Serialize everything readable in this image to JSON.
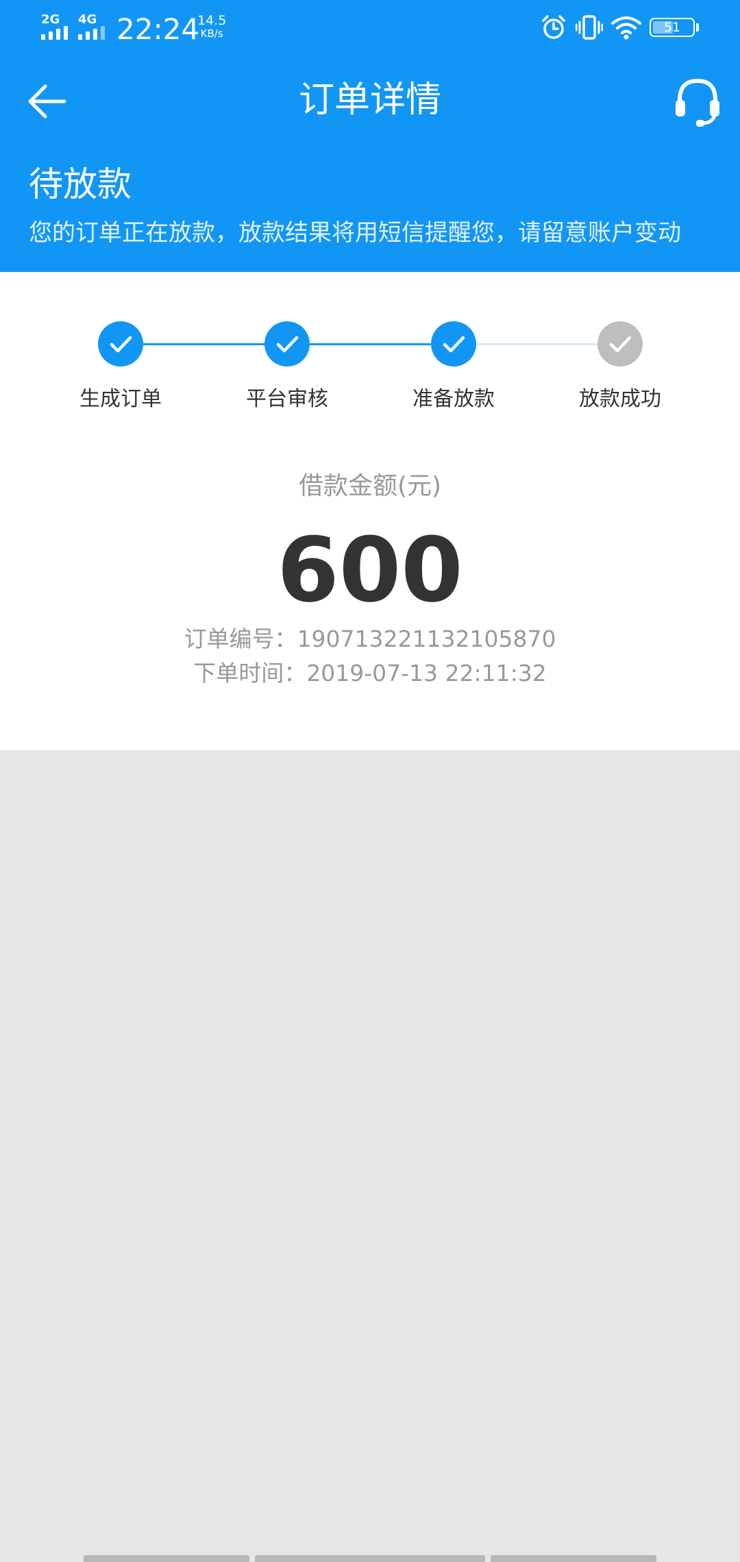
{
  "status_bar": {
    "sim1_network": "2G",
    "sim2_network": "4G",
    "time": "22:24",
    "speed_value": "14.5",
    "speed_unit": "KB/s",
    "battery_level": "51",
    "battery_fraction": 0.51,
    "icons": [
      "alarm-icon",
      "vibrate-icon",
      "wifi-icon",
      "battery-icon"
    ]
  },
  "header": {
    "title": "订单详情",
    "back_icon": "arrow-left-icon",
    "service_icon": "headset-icon"
  },
  "banner": {
    "status_title": "待放款",
    "status_desc": "您的订单正在放款，放款结果将用短信提醒您，请留意账户变动"
  },
  "steps": [
    {
      "label": "生成订单",
      "completed": true
    },
    {
      "label": "平台审核",
      "completed": true
    },
    {
      "label": "准备放款",
      "completed": true
    },
    {
      "label": "放款成功",
      "completed": false
    }
  ],
  "loan": {
    "amount_label": "借款金额(元)",
    "amount": "600",
    "order_no_label": "订单编号：",
    "order_no": "190713221132105870",
    "order_time_label": "下单时间：",
    "order_time": "2019-07-13 22:11:32"
  },
  "colors": {
    "primary": "#1296f5",
    "step_inactive": "#bdbdbd",
    "line_inactive": "#d6e8f5",
    "page_background": "#e6e6e6"
  }
}
